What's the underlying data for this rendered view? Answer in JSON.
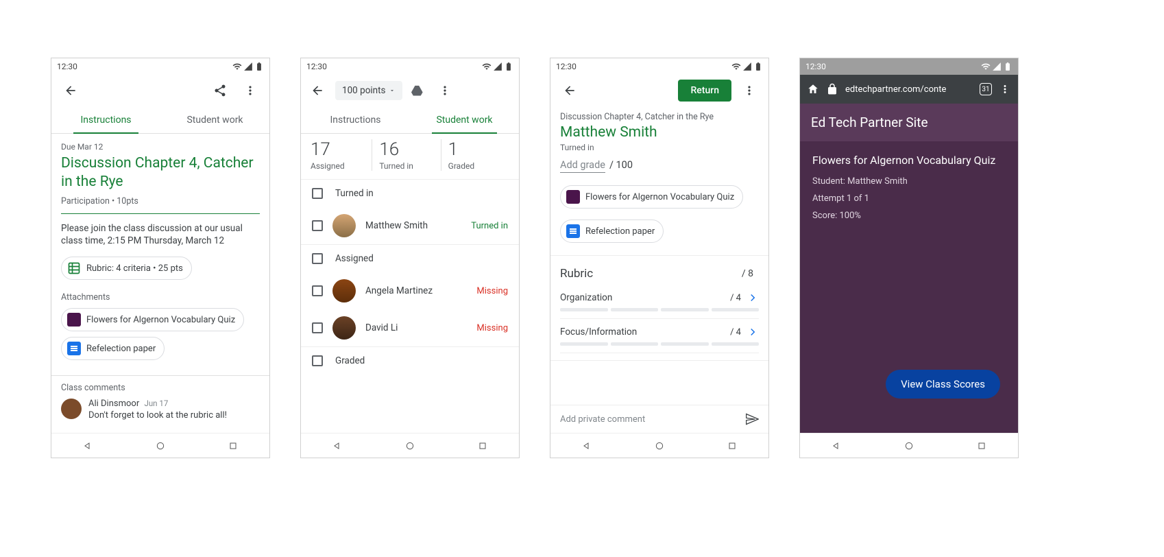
{
  "status_time": "12:30",
  "screen1": {
    "tabs": {
      "instructions": "Instructions",
      "student_work": "Student work"
    },
    "due": "Due Mar 12",
    "title": "Discussion Chapter 4, Catcher in the Rye",
    "meta": "Participation • 10pts",
    "desc": "Please join the class discussion at our usual class time, 2:15 PM Thursday, March 12",
    "rubric_chip": "Rubric: 4 criteria • 25 pts",
    "attachments_label": "Attachments",
    "attach1": "Flowers for Algernon Vocabulary Quiz",
    "attach2": "Refelection paper",
    "comments_label": "Class comments",
    "comment_name": "Ali Dinsmoor",
    "comment_date": "Jun 17",
    "comment_text": "Don't forget to look at the rubric all!"
  },
  "screen2": {
    "points": "100 points",
    "tabs": {
      "instructions": "Instructions",
      "student_work": "Student work"
    },
    "stats": {
      "assigned_n": "17",
      "assigned_l": "Assigned",
      "turned_n": "16",
      "turned_l": "Turned in",
      "graded_n": "1",
      "graded_l": "Graded"
    },
    "sec_turned": "Turned in",
    "sec_assigned": "Assigned",
    "sec_graded": "Graded",
    "students": {
      "s1_name": "Matthew Smith",
      "s1_status": "Turned in",
      "s2_name": "Angela Martinez",
      "s2_status": "Missing",
      "s3_name": "David Li",
      "s3_status": "Missing"
    }
  },
  "screen3": {
    "return": "Return",
    "breadcrumb": "Discussion Chapter 4, Catcher in the Rye",
    "student": "Matthew Smith",
    "status": "Turned in",
    "grade_placeholder": "Add grade",
    "grade_total": "/ 100",
    "attach1": "Flowers for Algernon Vocabulary Quiz",
    "attach2": "Refelection paper",
    "rubric_label": "Rubric",
    "rubric_total": "/ 8",
    "crit1": "Organization",
    "crit1_score": "/ 4",
    "crit2": "Focus/Information",
    "crit2_score": "/ 4",
    "comment_ph": "Add private comment"
  },
  "screen4": {
    "url": "edtechpartner.com/conte",
    "tab_count": "31",
    "site_title": "Ed Tech Partner Site",
    "quiz_title": "Flowers for Algernon Vocabulary Quiz",
    "line1": "Student: Matthew Smith",
    "line2": "Attempt 1 of 1",
    "line3": "Score: 100%",
    "button": "View Class Scores"
  }
}
